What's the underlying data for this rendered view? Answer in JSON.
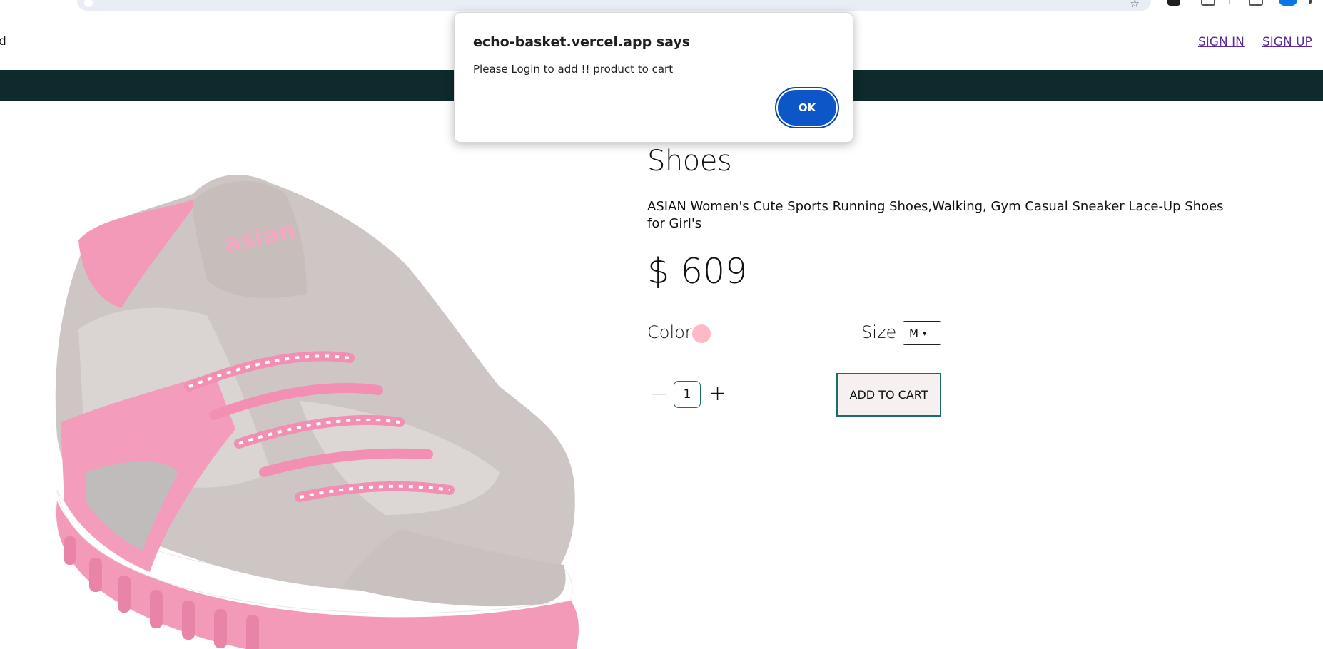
{
  "header": {
    "brand_fragment": "d",
    "sign_in": "SIGN IN",
    "sign_up": "SIGN UP"
  },
  "product": {
    "title": "Shoes",
    "description": "ASIAN Women's Cute Sports Running Shoes,Walking, Gym Casual Sneaker Lace-Up Shoes for Girl's",
    "price": "$ 609",
    "color_label": "Color",
    "color_value": "#ffb8c6",
    "size_label": "Size",
    "size_value": "M",
    "quantity": "1",
    "add_to_cart": "ADD TO CART"
  },
  "dialog": {
    "title": "echo-basket.vercel.app says",
    "message": "Please Login to add !! product to cart",
    "ok_label": "OK"
  },
  "colors": {
    "band": "#0e2a2d",
    "accent": "#1c6d6a",
    "link": "#5a2aa0",
    "ok_button": "#0c56c7"
  },
  "icons": [
    "star-icon",
    "minus-icon",
    "plus-icon",
    "chevron-down-icon"
  ]
}
